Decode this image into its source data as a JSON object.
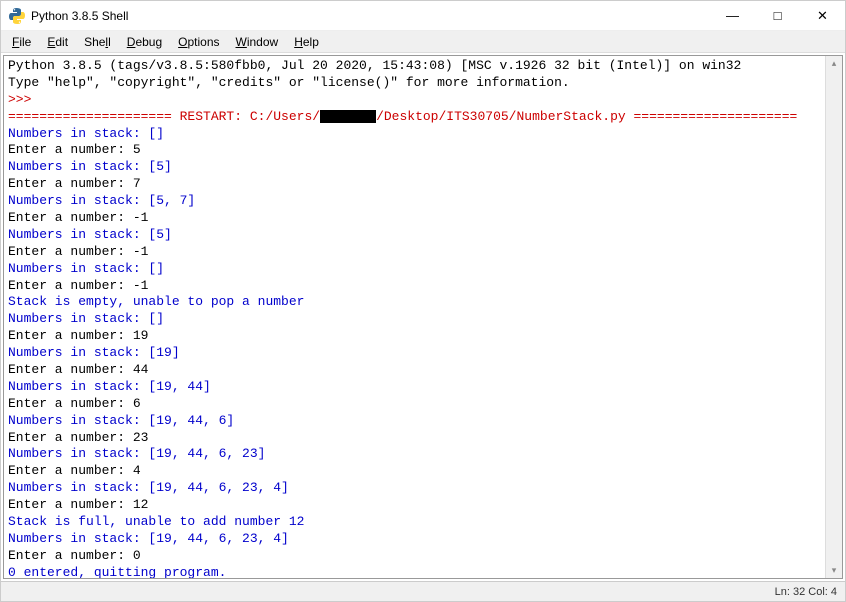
{
  "window": {
    "title": "Python 3.8.5 Shell",
    "minimize": "—",
    "maximize": "□",
    "close": "✕"
  },
  "menu": {
    "items": [
      {
        "label": "File",
        "underline": "F",
        "rest": "ile"
      },
      {
        "label": "Edit",
        "underline": "E",
        "rest": "dit"
      },
      {
        "label": "Shell",
        "underline": "l",
        "pre": "She",
        "rest": "l"
      },
      {
        "label": "Debug",
        "underline": "D",
        "rest": "ebug"
      },
      {
        "label": "Options",
        "underline": "O",
        "rest": "ptions"
      },
      {
        "label": "Window",
        "underline": "W",
        "rest": "indow"
      },
      {
        "label": "Help",
        "underline": "H",
        "rest": "elp"
      }
    ]
  },
  "console": {
    "version_line": "Python 3.8.5 (tags/v3.8.5:580fbb0, Jul 20 2020, 15:43:08) [MSC v.1926 32 bit (Intel)] on win32",
    "type_help_line": "Type \"help\", \"copyright\", \"credits\" or \"license()\" for more information.",
    "prompt": ">>>",
    "restart_prefix": "===================== RESTART: C:/Users/",
    "restart_suffix": "/Desktop/ITS30705/NumberStack.py =====================",
    "lines": [
      {
        "color": "blue",
        "text": "Numbers in stack: []"
      },
      {
        "color": "black",
        "prompt": "Enter a number: ",
        "input": "5"
      },
      {
        "color": "blue",
        "text": "Numbers in stack: [5]"
      },
      {
        "color": "black",
        "prompt": "Enter a number: ",
        "input": "7"
      },
      {
        "color": "blue",
        "text": "Numbers in stack: [5, 7]"
      },
      {
        "color": "black",
        "prompt": "Enter a number: ",
        "input": "-1"
      },
      {
        "color": "blue",
        "text": "Numbers in stack: [5]"
      },
      {
        "color": "black",
        "prompt": "Enter a number: ",
        "input": "-1"
      },
      {
        "color": "blue",
        "text": "Numbers in stack: []"
      },
      {
        "color": "black",
        "prompt": "Enter a number: ",
        "input": "-1"
      },
      {
        "color": "blue",
        "text": "Stack is empty, unable to pop a number"
      },
      {
        "color": "blue",
        "text": "Numbers in stack: []"
      },
      {
        "color": "black",
        "prompt": "Enter a number: ",
        "input": "19"
      },
      {
        "color": "blue",
        "text": "Numbers in stack: [19]"
      },
      {
        "color": "black",
        "prompt": "Enter a number: ",
        "input": "44"
      },
      {
        "color": "blue",
        "text": "Numbers in stack: [19, 44]"
      },
      {
        "color": "black",
        "prompt": "Enter a number: ",
        "input": "6"
      },
      {
        "color": "blue",
        "text": "Numbers in stack: [19, 44, 6]"
      },
      {
        "color": "black",
        "prompt": "Enter a number: ",
        "input": "23"
      },
      {
        "color": "blue",
        "text": "Numbers in stack: [19, 44, 6, 23]"
      },
      {
        "color": "black",
        "prompt": "Enter a number: ",
        "input": "4"
      },
      {
        "color": "blue",
        "text": "Numbers in stack: [19, 44, 6, 23, 4]"
      },
      {
        "color": "black",
        "prompt": "Enter a number: ",
        "input": "12"
      },
      {
        "color": "blue",
        "text": "Stack is full, unable to add number 12"
      },
      {
        "color": "blue",
        "text": "Numbers in stack: [19, 44, 6, 23, 4]"
      },
      {
        "color": "black",
        "prompt": "Enter a number: ",
        "input": "0"
      },
      {
        "color": "blue",
        "text": "0 entered, quitting program."
      }
    ]
  },
  "status": {
    "text": "Ln: 32  Col: 4"
  },
  "icons": {
    "python_fg": "#ffd43b",
    "python_bg": "#306998"
  },
  "scrollbar": {
    "up": "▴",
    "down": "▾"
  }
}
